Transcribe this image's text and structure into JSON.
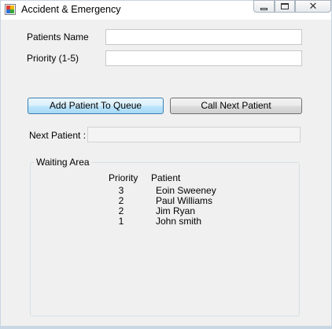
{
  "window": {
    "title": "Accident & Emergency",
    "icon": "form-icon",
    "controls": {
      "minimize": "minimize-icon",
      "maximize": "maximize-icon",
      "close": "close-icon"
    }
  },
  "form": {
    "patients_name_label": "Patients Name",
    "patients_name_value": "",
    "priority_label": "Priority (1-5)",
    "priority_value": "",
    "add_button_label": "Add Patient To Queue",
    "call_button_label": "Call Next Patient",
    "next_patient_label": "Next Patient :",
    "next_patient_value": ""
  },
  "waiting_area": {
    "title": "Waiting Area",
    "columns": [
      "Priority",
      "Patient"
    ],
    "rows": [
      {
        "priority": "3",
        "patient": "Eoin Sweeney"
      },
      {
        "priority": "2",
        "patient": "Paul Williams"
      },
      {
        "priority": "2",
        "patient": "Jim Ryan"
      },
      {
        "priority": "1",
        "patient": "John smith"
      }
    ]
  }
}
